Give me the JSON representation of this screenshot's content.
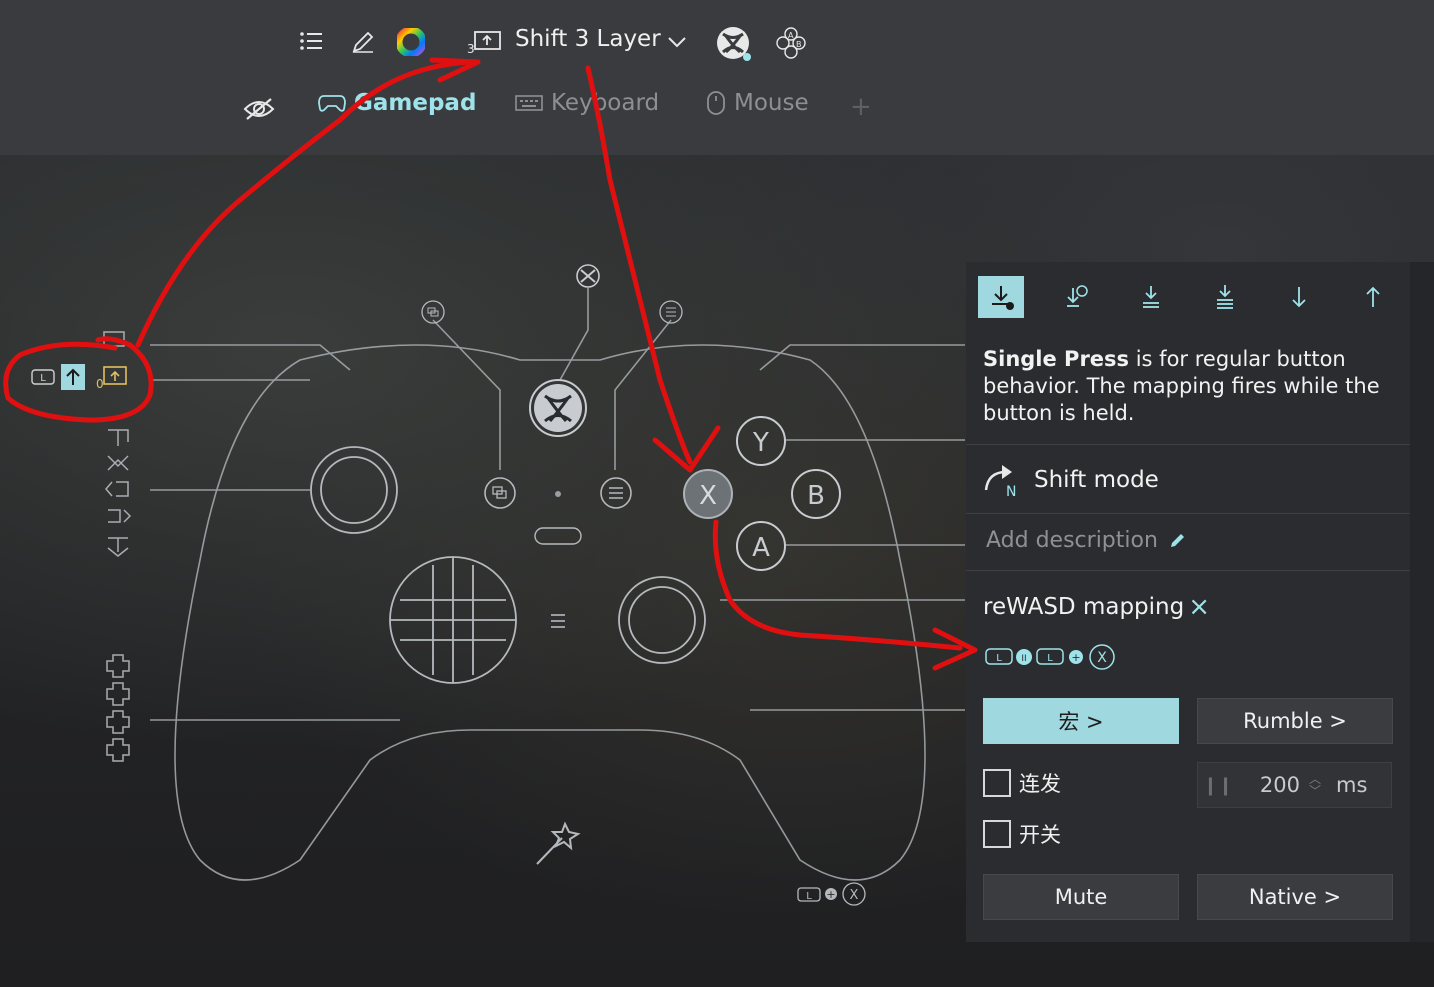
{
  "header": {
    "layer_label": "Shift 3 Layer",
    "layer_number": "3",
    "icons": [
      "list-icon",
      "pencil-icon",
      "color-wheel-icon",
      "layer-icon",
      "chevron-down-icon",
      "xbox-icon",
      "abxy-icon"
    ]
  },
  "tabs": [
    {
      "label": "Gamepad",
      "active": true
    },
    {
      "label": "Keyboard",
      "active": false
    },
    {
      "label": "Mouse",
      "active": false
    }
  ],
  "tab_add": "+",
  "controller": {
    "face_buttons": {
      "y": "Y",
      "x": "X",
      "b": "B",
      "a": "A"
    },
    "side_shift_number": "0",
    "bottom_combo_symbols": [
      "L",
      "+",
      "X"
    ]
  },
  "panel": {
    "press_types": [
      "single-press",
      "long-press",
      "double-press",
      "triple-press",
      "press-down",
      "release"
    ],
    "selected_press": "single-press",
    "description_bold": "Single Press",
    "description_rest": " is for regular button behavior. The mapping fires while the button is held.",
    "shift_mode_label": "Shift mode",
    "shift_mode_badge": "N",
    "add_description": "Add description",
    "mapping_title": "reWASD mapping",
    "mapping_close": "×",
    "combo_symbols": [
      "L",
      "II",
      "L",
      "+",
      "X"
    ],
    "macro_button": "宏 >",
    "rumble_button": "Rumble >",
    "turbo_label": "连发",
    "toggle_label": "开关",
    "interval_value": "200",
    "interval_unit": "ms",
    "mute_button": "Mute",
    "native_button": "Native >"
  },
  "colors": {
    "accent": "#9fd8de",
    "accent_text": "#9fe3ea",
    "annotation": "#e01010",
    "panel_bg": "#2b2c2f",
    "topbar_bg": "#3a3b3f"
  }
}
